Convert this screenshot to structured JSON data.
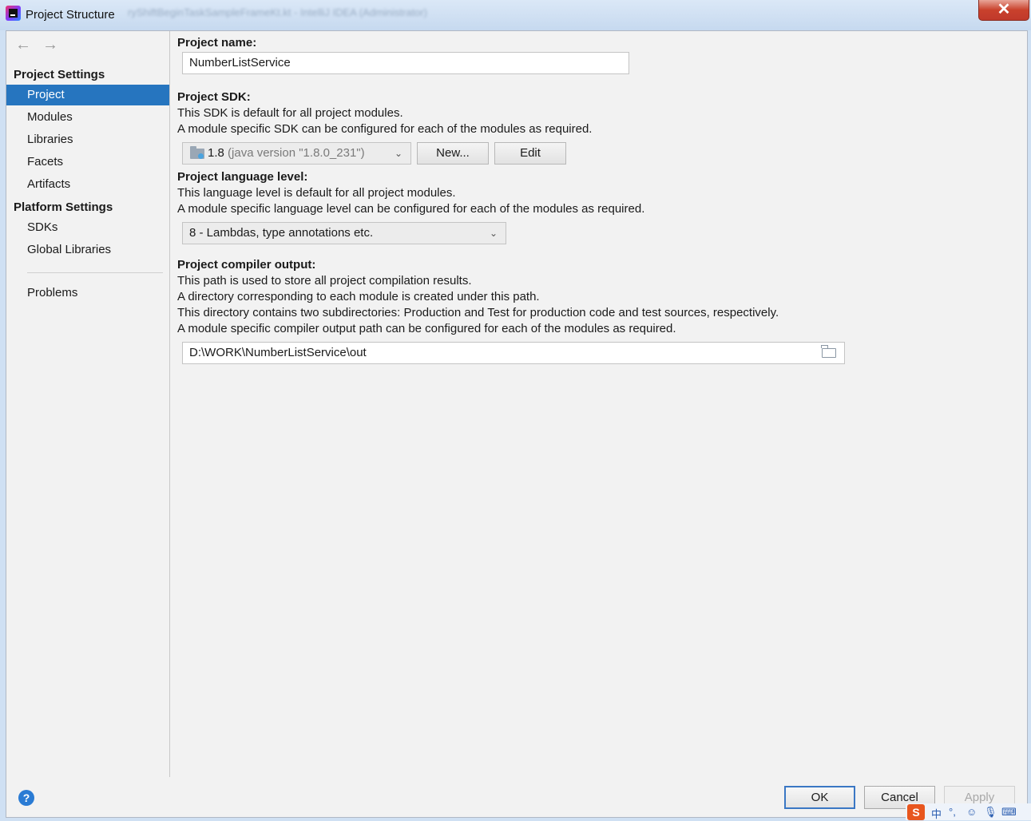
{
  "window": {
    "title": "Project Structure",
    "background_title": "ryShiftBeginTaskSampleFrameKt.kt - IntelliJ IDEA (Administrator)",
    "close_symbol": "✕"
  },
  "sidebar": {
    "back_symbol": "←",
    "forward_symbol": "→",
    "project_settings_heading": "Project Settings",
    "project_settings_items": [
      {
        "label": "Project",
        "selected": true
      },
      {
        "label": "Modules",
        "selected": false
      },
      {
        "label": "Libraries",
        "selected": false
      },
      {
        "label": "Facets",
        "selected": false
      },
      {
        "label": "Artifacts",
        "selected": false
      }
    ],
    "platform_settings_heading": "Platform Settings",
    "platform_settings_items": [
      {
        "label": "SDKs"
      },
      {
        "label": "Global Libraries"
      }
    ],
    "problems_label": "Problems"
  },
  "project": {
    "name_label": "Project name:",
    "name_value": "NumberListService",
    "sdk_label": "Project SDK:",
    "sdk_desc_1": "This SDK is default for all project modules.",
    "sdk_desc_2": "A module specific SDK can be configured for each of the modules as required.",
    "sdk_version": "1.8",
    "sdk_detail": "(java version \"1.8.0_231\")",
    "sdk_new_button": "New...",
    "sdk_edit_button": "Edit",
    "lang_label": "Project language level:",
    "lang_desc_1": "This language level is default for all project modules.",
    "lang_desc_2": "A module specific language level can be configured for each of the modules as required.",
    "lang_value": "8 - Lambdas, type annotations etc.",
    "output_label": "Project compiler output:",
    "output_desc_1": "This path is used to store all project compilation results.",
    "output_desc_2": "A directory corresponding to each module is created under this path.",
    "output_desc_3": "This directory contains two subdirectories: Production and Test for production code and test sources, respectively.",
    "output_desc_4": "A module specific compiler output path can be configured for each of the modules as required.",
    "output_value": "D:\\WORK\\NumberListService\\out"
  },
  "footer": {
    "help_symbol": "?",
    "ok_label": "OK",
    "cancel_label": "Cancel",
    "apply_label": "Apply"
  },
  "tray": {
    "ime_logo": "S",
    "ime_mode": "中",
    "punct": "°,",
    "emoji": "☺",
    "mic": "🎙",
    "keyboard": "⌨"
  },
  "colors": {
    "selection": "#2675bf",
    "panel_bg": "#f2f2f2",
    "ok_border": "#3a77c4"
  }
}
